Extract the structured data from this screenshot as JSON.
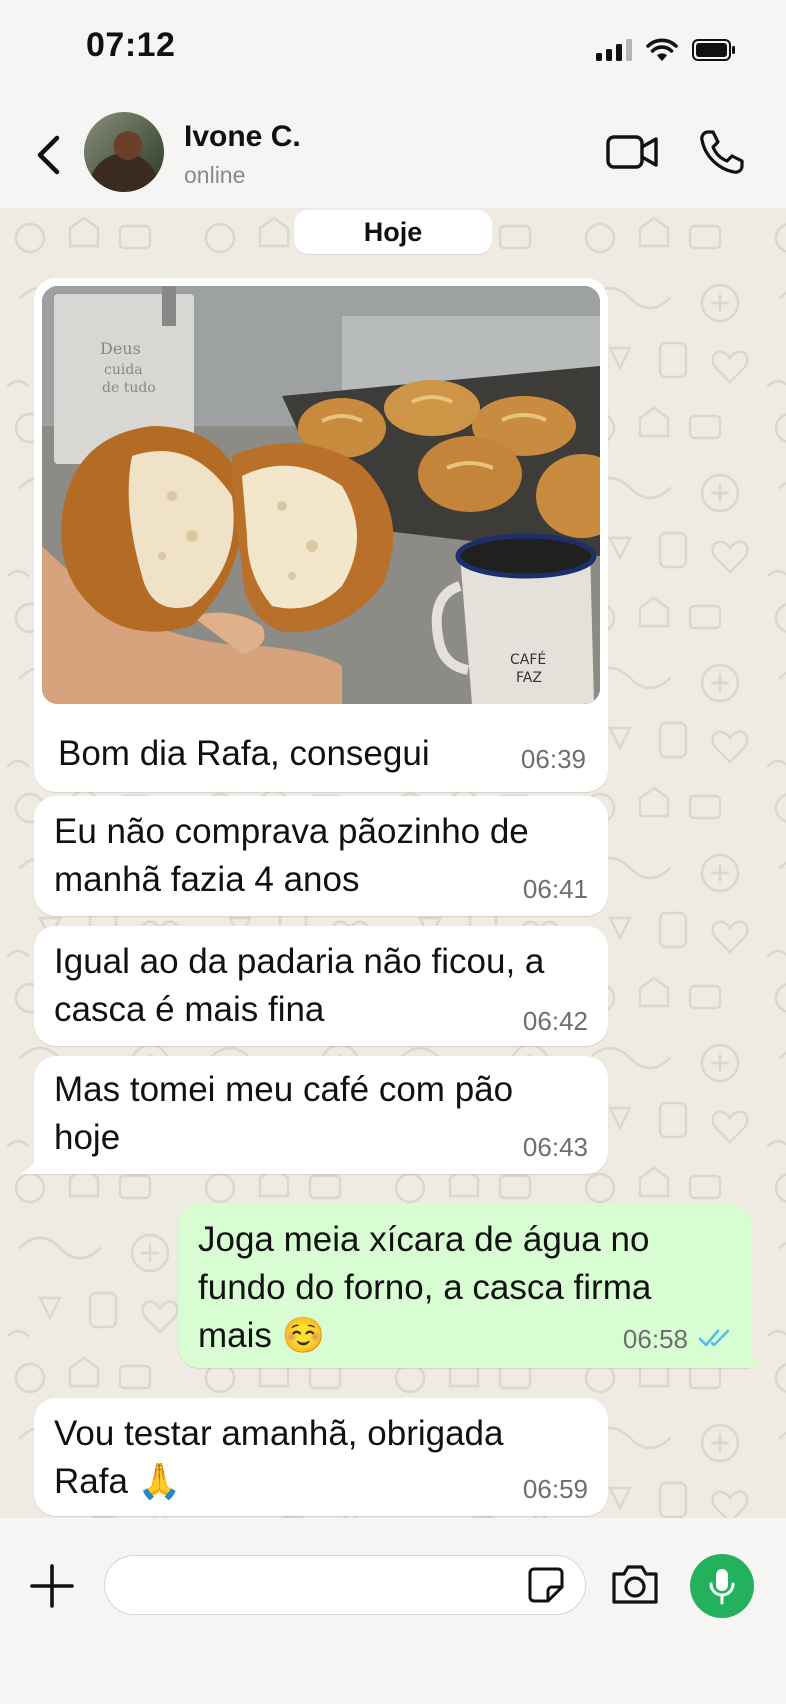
{
  "status_bar": {
    "time": "07:12",
    "icons": [
      "cellular-signal-icon",
      "wifi-icon",
      "battery-icon"
    ]
  },
  "header": {
    "contact_name": "Ivone C.",
    "contact_status": "online",
    "icons": [
      "back-chevron-icon",
      "video-camera-icon",
      "phone-icon"
    ]
  },
  "chat": {
    "date_label": "Hoje",
    "messages": [
      {
        "direction": "in",
        "type": "image",
        "caption": "Bom dia Rafa, consegui",
        "time": "06:39"
      },
      {
        "direction": "in",
        "type": "text",
        "lines": [
          "Eu não comprava pãozinho de",
          "manhã fazia 4 anos"
        ],
        "time": "06:41"
      },
      {
        "direction": "in",
        "type": "text",
        "lines": [
          "Igual ao da padaria não ficou, a",
          "casca é mais fina"
        ],
        "time": "06:42"
      },
      {
        "direction": "in",
        "type": "text",
        "lines": [
          "Mas tomei meu café com pão",
          "hoje"
        ],
        "time": "06:43"
      },
      {
        "direction": "out",
        "type": "text",
        "lines": [
          "Joga meia xícara de água no",
          "fundo do forno, a casca firma",
          "mais ☺️"
        ],
        "time": "06:58",
        "status": "read"
      },
      {
        "direction": "in",
        "type": "text",
        "lines": [
          "Vou testar amanhã, obrigada",
          "Rafa 🙏"
        ],
        "time": "06:59"
      }
    ],
    "photo_text": {
      "towel": [
        "Deus",
        "cuida",
        "de tudo"
      ],
      "mug": [
        "CAFÉ",
        "FAZ"
      ]
    }
  },
  "composer": {
    "placeholder": "",
    "icons": [
      "plus-icon",
      "sticker-icon",
      "camera-icon",
      "microphone-icon"
    ]
  },
  "colors": {
    "incoming_bubble": "#ffffff",
    "outgoing_bubble": "#d9fdd3",
    "chat_background": "#efeae2",
    "accent_green": "#24b15e",
    "read_tick": "#53bdeb"
  }
}
